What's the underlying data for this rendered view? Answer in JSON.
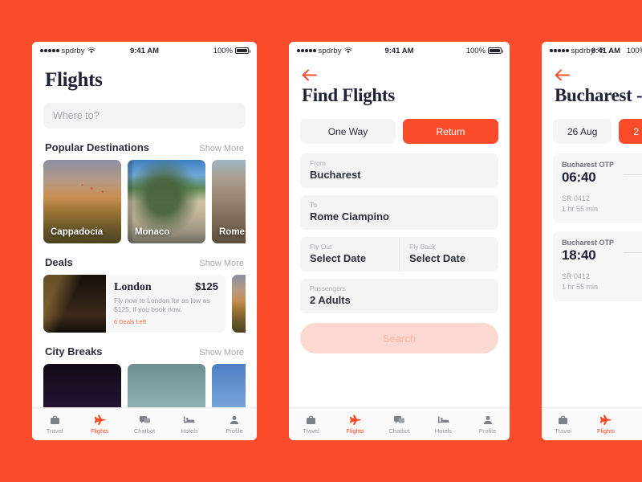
{
  "theme": {
    "brand": "#FA4B2A",
    "ink": "#1E2235",
    "muted": "#A7A9AE",
    "field": "#F4F4F4"
  },
  "status_bar": {
    "carrier": "spdrby",
    "time": "9:41 AM",
    "battery": "100%",
    "signal_dots": 5
  },
  "screen1": {
    "title": "Flights",
    "search_placeholder": "Where to?",
    "sections": [
      {
        "title": "Popular Destinations",
        "action": "Show More",
        "cards": [
          {
            "label": "Cappadocia",
            "photo": "ph-capp"
          },
          {
            "label": "Monaco",
            "photo": "ph-mona"
          },
          {
            "label": "Rome",
            "photo": "ph-rome"
          }
        ]
      },
      {
        "title": "Deals",
        "action": "Show More",
        "deal": {
          "city": "London",
          "price": "$125",
          "description": "Fly now to London for as low as $125, if you book now.",
          "deals_left": "6 Deals Left",
          "photo": "ph-lond",
          "peek_photo": "ph-capp"
        }
      },
      {
        "title": "City Breaks",
        "action": "Show More",
        "cards": [
          {
            "label": "",
            "photo": "ph-city1"
          },
          {
            "label": "",
            "photo": "ph-city2"
          },
          {
            "label": "",
            "photo": "ph-city3"
          }
        ]
      }
    ],
    "tabs": [
      {
        "label": "Travel",
        "icon": "suitcase-icon",
        "active": false
      },
      {
        "label": "Flights",
        "icon": "plane-icon",
        "active": true
      },
      {
        "label": "Chatbot",
        "icon": "chat-icon",
        "active": false
      },
      {
        "label": "Hotels",
        "icon": "bed-icon",
        "active": false
      },
      {
        "label": "Profile",
        "icon": "person-icon",
        "active": false
      }
    ]
  },
  "screen2": {
    "title": "Find Flights",
    "trip_types": [
      {
        "label": "One Way",
        "selected": false
      },
      {
        "label": "Return",
        "selected": true
      }
    ],
    "fields": [
      {
        "label": "From",
        "value": "Bucharest"
      },
      {
        "label": "To",
        "value": "Rome Ciampino"
      }
    ],
    "date_fields": [
      {
        "label": "Fly Out",
        "value": "Select Date"
      },
      {
        "label": "Fly Back",
        "value": "Select Date"
      }
    ],
    "passengers": {
      "label": "Passengers",
      "value": "2 Adults"
    },
    "submit": {
      "label": "Search",
      "disabled": true
    },
    "tabs": [
      {
        "label": "Travel",
        "icon": "suitcase-icon",
        "active": false
      },
      {
        "label": "Flights",
        "icon": "plane-icon",
        "active": true
      },
      {
        "label": "Chatbot",
        "icon": "chat-icon",
        "active": false
      },
      {
        "label": "Hotels",
        "icon": "bed-icon",
        "active": false
      },
      {
        "label": "Profile",
        "icon": "person-icon",
        "active": false
      }
    ]
  },
  "screen3": {
    "title": "Bucharest -",
    "dates": [
      {
        "label": "26 Aug",
        "selected": false
      },
      {
        "label": "2",
        "selected": true
      }
    ],
    "flights": [
      {
        "origin": "Bucharest OTP",
        "time": "06:40",
        "flight_no": "SR 0412",
        "duration": "1 hr 55 min"
      },
      {
        "origin": "Bucharest OTP",
        "time": "18:40",
        "flight_no": "SR 0412",
        "duration": "1 hr 55 min"
      }
    ],
    "tabs": [
      {
        "label": "Travel",
        "icon": "suitcase-icon",
        "active": false
      },
      {
        "label": "Flights",
        "icon": "plane-icon",
        "active": true
      }
    ]
  }
}
